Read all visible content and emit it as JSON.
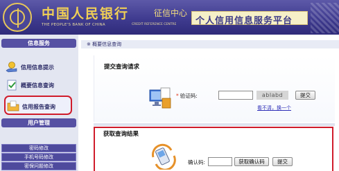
{
  "header": {
    "bank_name_cn": "中国人民银行",
    "bank_sub_cn": "征信中心",
    "bank_name_en": "THE PEOPLE'S BANK OF CHINA",
    "credit_center_en": "CREDIT REFERENCE CENTRE",
    "platform_title": "个人信用信息服务平台"
  },
  "sidebar": {
    "section1_title": "信息服务",
    "items": [
      {
        "label": "信用信息提示",
        "icon": "hand-coin-icon"
      },
      {
        "label": "概要信息查询",
        "icon": "checkmark-doc-icon"
      },
      {
        "label": "信用报告查询",
        "icon": "folder-report-icon"
      }
    ],
    "section2_title": "用户管理",
    "links": [
      "密码修改",
      "手机号码修改",
      "密保问题修改"
    ]
  },
  "main": {
    "breadcrumb": "※ 概要信息查询",
    "submit_section": {
      "title": "提交查询请求",
      "code_label": "验证码:",
      "code_value": "",
      "captcha_text": "ablabd",
      "submit_button": "提交",
      "refresh_link": "看不清，换一个"
    },
    "result_section": {
      "title": "获取查询结果",
      "confirm_label": "确认码:",
      "confirm_value": "",
      "get_code_button": "获取确认码",
      "submit_button": "提交"
    }
  },
  "colors": {
    "header_bg": "#3f3b8f",
    "gold": "#f0cf55",
    "highlight_red": "#d01b2a",
    "sidebar_bg": "#e3e6f1"
  }
}
